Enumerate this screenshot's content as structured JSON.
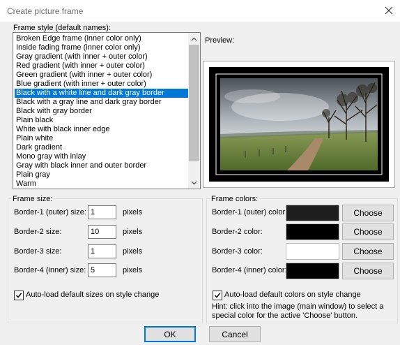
{
  "window": {
    "title": "Create picture frame"
  },
  "frame_style": {
    "group_label": "Frame style (default names):",
    "items": [
      "Broken Edge frame (inner color only)",
      "Inside fading frame (inner color only)",
      "Gray gradient (with inner + outer color)",
      "Red gradient (with inner + outer color)",
      "Green gradient (with inner + outer color)",
      "Blue gradient (with inner + outer color)",
      "Black with a white line and dark gray border",
      "Black with a gray line and dark gray border",
      "Black with gray border",
      "Plain black",
      "White with black inner edge",
      "Plain white",
      "Dark gradient",
      "Mono gray with inlay",
      "Gray with black inner and outer border",
      "Plain gray",
      "Warm"
    ],
    "selected_index": 6
  },
  "preview": {
    "label": "Preview:"
  },
  "frame_size": {
    "group_label": "Frame size:",
    "rows": [
      {
        "label": "Border-1 (outer) size:",
        "value": "1",
        "unit": "pixels"
      },
      {
        "label": "Border-2 size:",
        "value": "10",
        "unit": "pixels"
      },
      {
        "label": "Border-3 size:",
        "value": "1",
        "unit": "pixels"
      },
      {
        "label": "Border-4 (inner) size:",
        "value": "5",
        "unit": "pixels"
      }
    ],
    "autoload_label": "Auto-load default sizes on style change",
    "autoload_checked": true
  },
  "frame_colors": {
    "group_label": "Frame colors:",
    "rows": [
      {
        "label": "Border-1 (outer) color:",
        "color": "#1e1e1e",
        "button": "Choose"
      },
      {
        "label": "Border-2 color:",
        "color": "#000000",
        "button": "Choose"
      },
      {
        "label": "Border-3 color:",
        "color": "#ffffff",
        "button": "Choose"
      },
      {
        "label": "Border-4 (inner) color:",
        "color": "#000000",
        "button": "Choose"
      }
    ],
    "autoload_label": "Auto-load default colors on style change",
    "autoload_checked": true,
    "hint": "Hint: click into the image (main window) to select a special color for the active 'Choose' button."
  },
  "buttons": {
    "ok": "OK",
    "cancel": "Cancel"
  },
  "colors": {
    "selection": "#0078d7",
    "dialog_bg": "#f0f0f0"
  }
}
